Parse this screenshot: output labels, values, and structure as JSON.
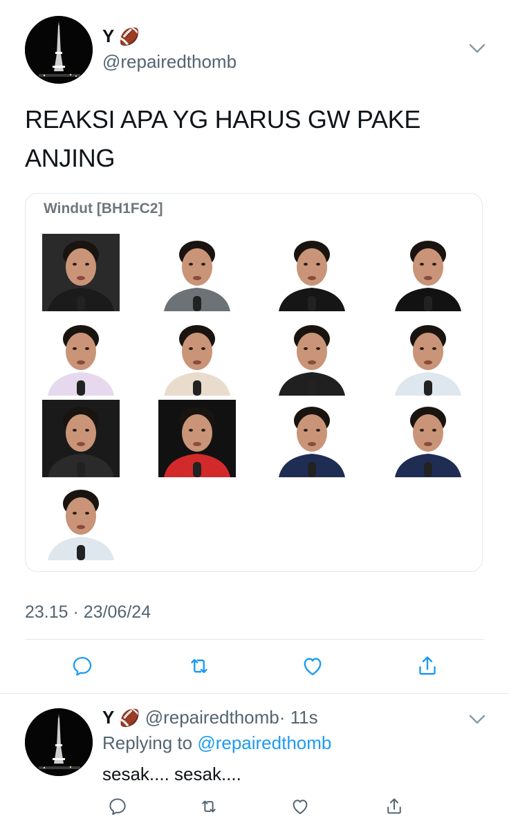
{
  "tweet": {
    "author_name": "Y",
    "author_emoji": "🏈",
    "author_handle": "@repairedthomb",
    "text_line1": "REAKSI APA YG HARUS GW PAKE",
    "text_line2": "ANJING",
    "card": {
      "title": "Windut [BH1FC2]",
      "emotes": [
        {
          "icon": "emote-middle-fingers",
          "bg": "#2a2a2a",
          "shirt": "#1b1b1b"
        },
        {
          "icon": "emote-tongue-out",
          "bg": "#ffffff",
          "shirt": "#6d7276"
        },
        {
          "icon": "emote-hands-face",
          "bg": "#ffffff",
          "shirt": "#161616"
        },
        {
          "icon": "emote-smirk",
          "bg": "#ffffff",
          "shirt": "#121212"
        },
        {
          "icon": "emote-tongue-lilac",
          "bg": "#ffffff",
          "shirt": "#e6d9ee"
        },
        {
          "icon": "emote-closeup-tongue",
          "bg": "#ffffff",
          "shirt": "#e9dccd"
        },
        {
          "icon": "emote-crying-mic",
          "bg": "#ffffff",
          "shirt": "#202020"
        },
        {
          "icon": "emote-gameboy-shirt",
          "bg": "#ffffff",
          "shirt": "#dfe7ee"
        },
        {
          "icon": "emote-pink-face",
          "bg": "#1a1a1a",
          "shirt": "#2a2a2a"
        },
        {
          "icon": "emote-helmet",
          "bg": "#111111",
          "shirt": "#d22a2a"
        },
        {
          "icon": "emote-kopiah-dark",
          "bg": "#ffffff",
          "shirt": "#1f2d55"
        },
        {
          "icon": "emote-kopiah-suit",
          "bg": "#ffffff",
          "shirt": "#1f2d55"
        },
        {
          "icon": "emote-gameboy-mirror",
          "bg": "#ffffff",
          "shirt": "#dfe7ee"
        }
      ]
    },
    "timestamp": "23.15 · 23/06/24"
  },
  "reply": {
    "author_name": "Y",
    "author_emoji": "🏈",
    "author_handle": "@repairedthomb",
    "time": "· 11s",
    "replying_prefix": "Replying to",
    "replying_handle": "@repairedthomb",
    "text": "sesak.... sesak...."
  },
  "colors": {
    "link": "#1d9bf0",
    "icon_gray": "#8899a6",
    "divider": "#e1e8ed"
  }
}
